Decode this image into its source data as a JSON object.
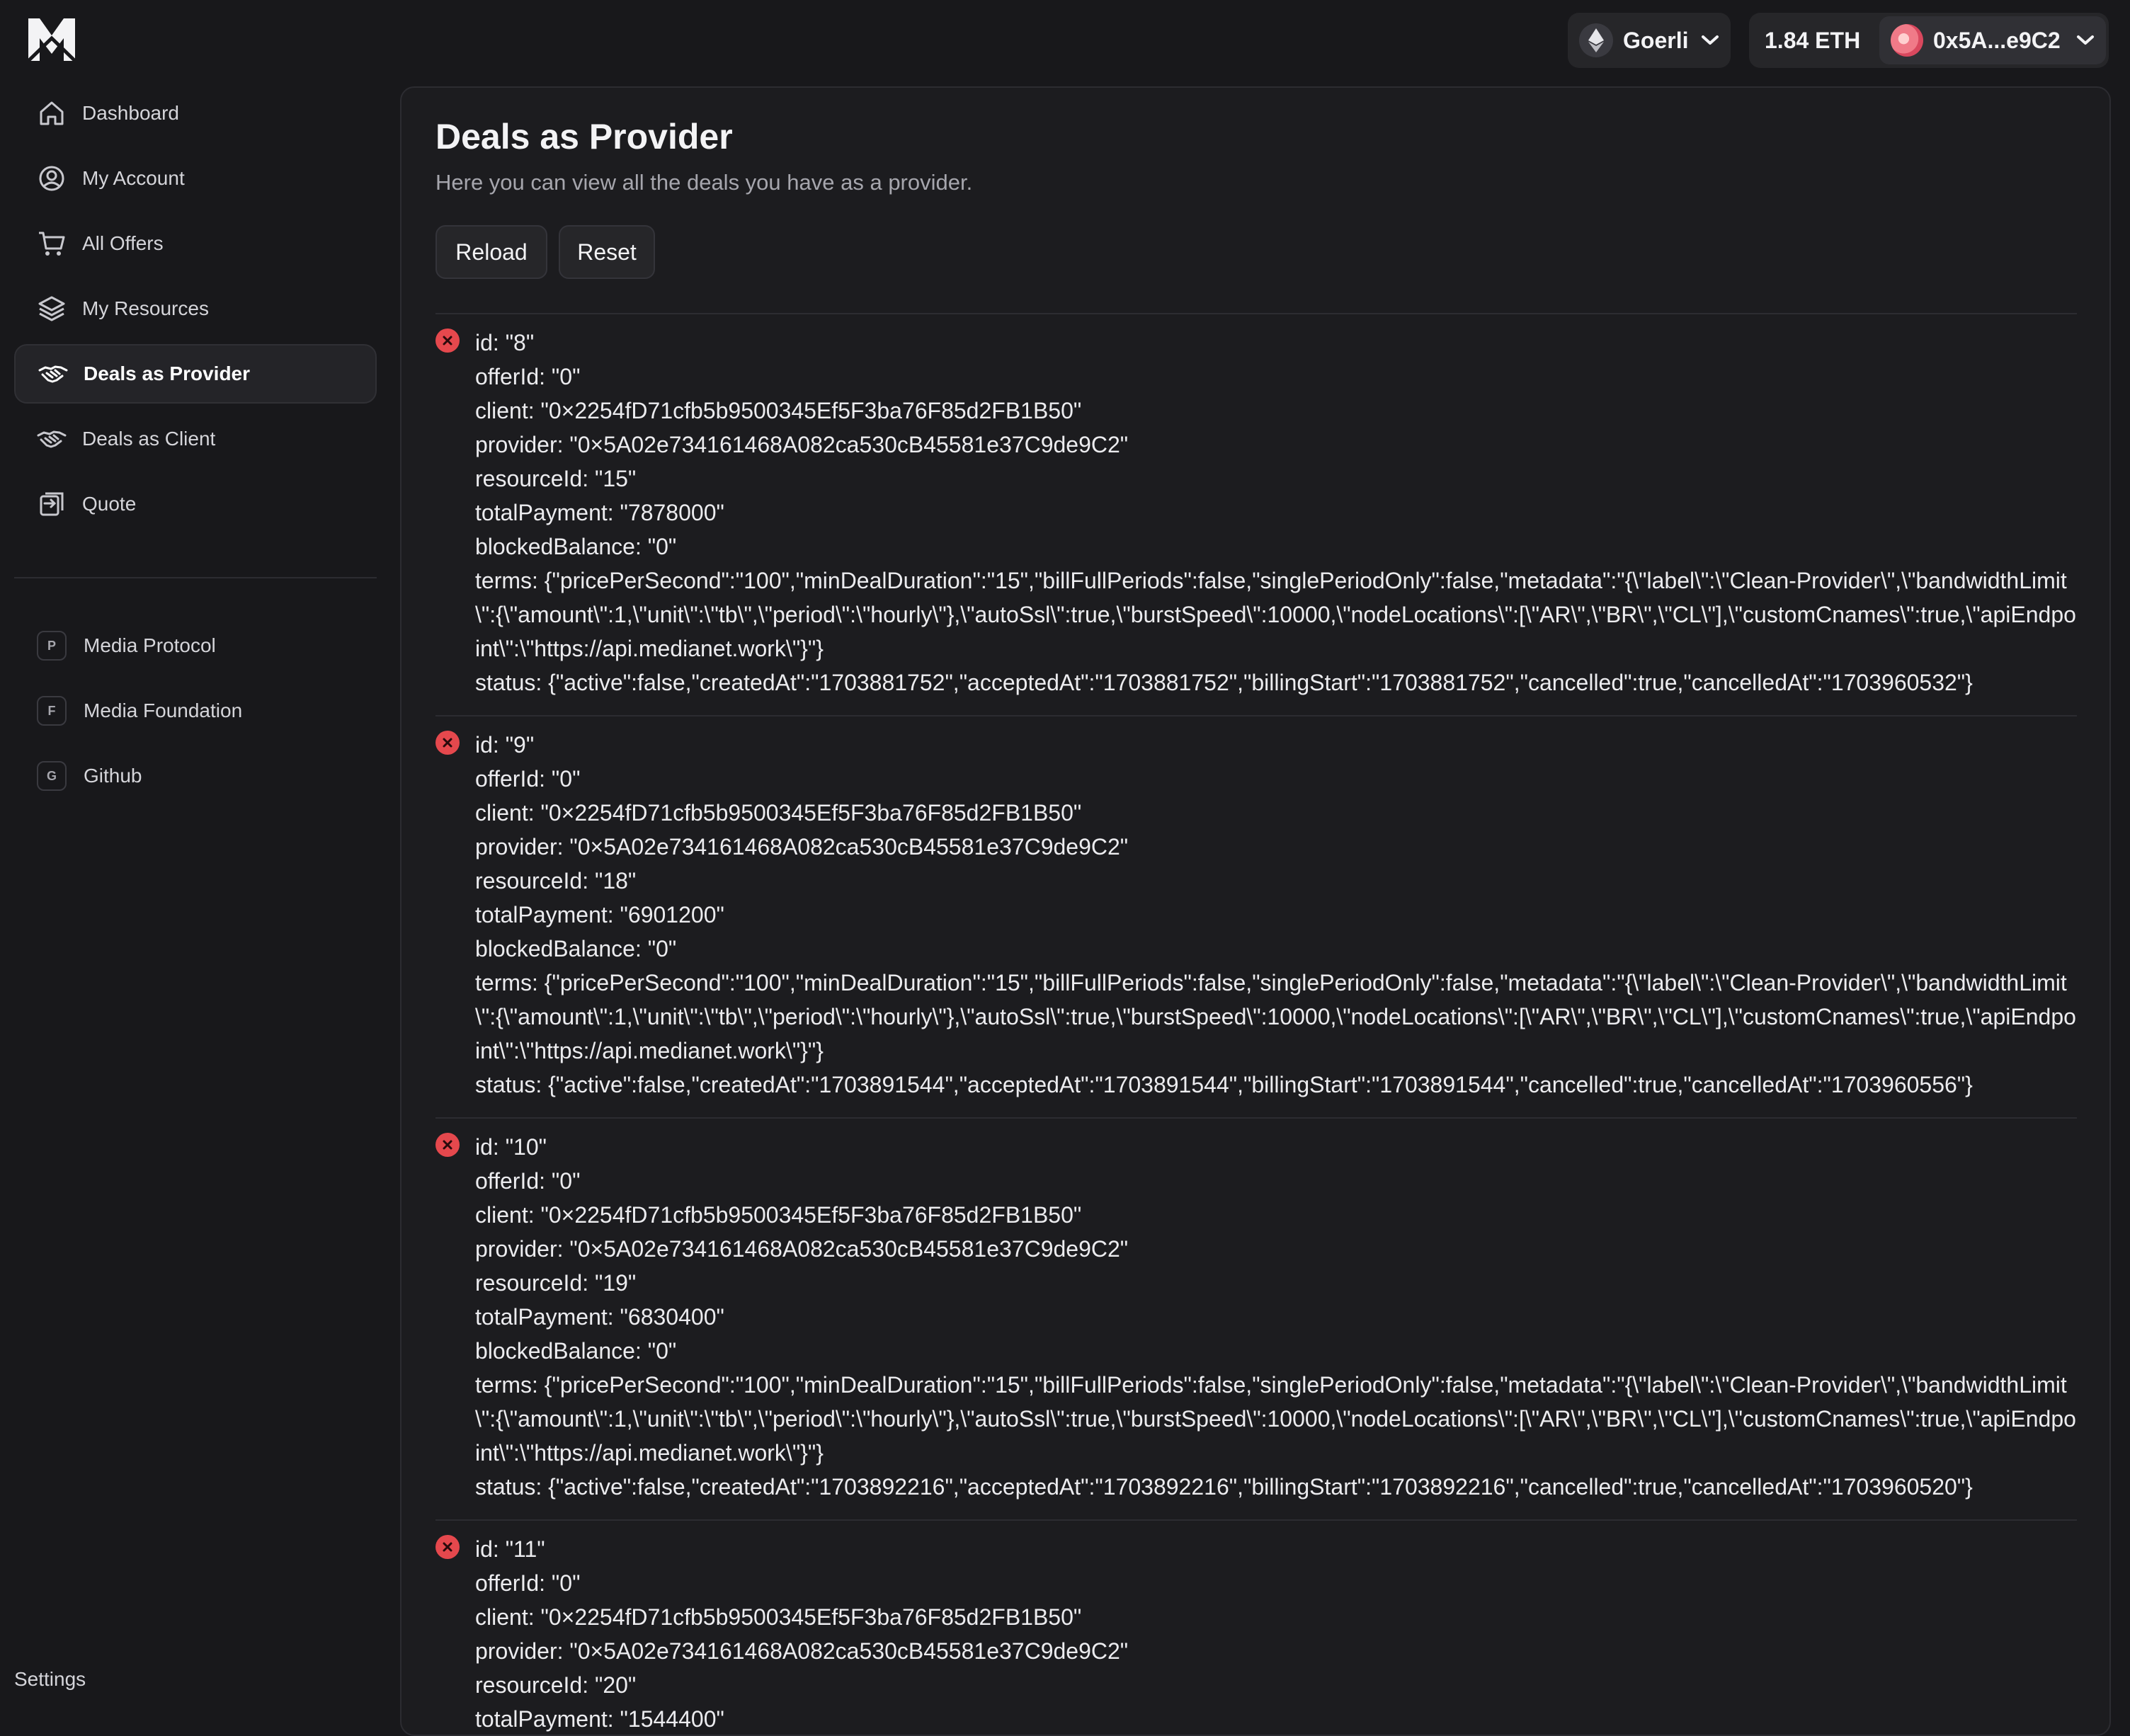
{
  "header": {
    "network_label": "Goerli",
    "balance": "1.84 ETH",
    "address": "0x5A...e9C2"
  },
  "sidebar": {
    "items": [
      {
        "label": "Dashboard",
        "icon": "home-icon"
      },
      {
        "label": "My Account",
        "icon": "user-circle-icon"
      },
      {
        "label": "All Offers",
        "icon": "cart-icon"
      },
      {
        "label": "My Resources",
        "icon": "layers-icon"
      },
      {
        "label": "Deals as Provider",
        "icon": "handshake-icon",
        "active": true
      },
      {
        "label": "Deals as Client",
        "icon": "handshake-icon"
      },
      {
        "label": "Quote",
        "icon": "quote-icon"
      }
    ],
    "links": [
      {
        "letter": "P",
        "label": "Media Protocol"
      },
      {
        "letter": "F",
        "label": "Media Foundation"
      },
      {
        "letter": "G",
        "label": "Github"
      }
    ],
    "settings_label": "Settings"
  },
  "main": {
    "title": "Deals as Provider",
    "subtitle": "Here you can view all the deals you have as a provider.",
    "reload_label": "Reload",
    "reset_label": "Reset",
    "deals": [
      {
        "id": "id: \"8\"",
        "offerId": "offerId: \"0\"",
        "client": "client: \"0×2254fD71cfb5b9500345Ef5F3ba76F85d2FB1B50\"",
        "provider": "provider: \"0×5A02e734161468A082ca530cB45581e37C9de9C2\"",
        "resourceId": "resourceId: \"15\"",
        "totalPayment": "totalPayment: \"7878000\"",
        "blockedBalance": "blockedBalance: \"0\"",
        "terms": "terms: {\"pricePerSecond\":\"100\",\"minDealDuration\":\"15\",\"billFullPeriods\":false,\"singlePeriodOnly\":false,\"metadata\":\"{\\\"label\\\":\\\"Clean-Provider\\\",\\\"bandwidthLimit\\\":{\\\"amount\\\":1,\\\"unit\\\":\\\"tb\\\",\\\"period\\\":\\\"hourly\\\"},\\\"autoSsl\\\":true,\\\"burstSpeed\\\":10000,\\\"nodeLocations\\\":[\\\"AR\\\",\\\"BR\\\",\\\"CL\\\"],\\\"customCnames\\\":true,\\\"apiEndpoint\\\":\\\"https://api.medianet.work\\\"}\"}",
        "status": "status: {\"active\":false,\"createdAt\":\"1703881752\",\"acceptedAt\":\"1703881752\",\"billingStart\":\"1703881752\",\"cancelled\":true,\"cancelledAt\":\"1703960532\"}"
      },
      {
        "id": "id: \"9\"",
        "offerId": "offerId: \"0\"",
        "client": "client: \"0×2254fD71cfb5b9500345Ef5F3ba76F85d2FB1B50\"",
        "provider": "provider: \"0×5A02e734161468A082ca530cB45581e37C9de9C2\"",
        "resourceId": "resourceId: \"18\"",
        "totalPayment": "totalPayment: \"6901200\"",
        "blockedBalance": "blockedBalance: \"0\"",
        "terms": "terms: {\"pricePerSecond\":\"100\",\"minDealDuration\":\"15\",\"billFullPeriods\":false,\"singlePeriodOnly\":false,\"metadata\":\"{\\\"label\\\":\\\"Clean-Provider\\\",\\\"bandwidthLimit\\\":{\\\"amount\\\":1,\\\"unit\\\":\\\"tb\\\",\\\"period\\\":\\\"hourly\\\"},\\\"autoSsl\\\":true,\\\"burstSpeed\\\":10000,\\\"nodeLocations\\\":[\\\"AR\\\",\\\"BR\\\",\\\"CL\\\"],\\\"customCnames\\\":true,\\\"apiEndpoint\\\":\\\"https://api.medianet.work\\\"}\"}",
        "status": "status: {\"active\":false,\"createdAt\":\"1703891544\",\"acceptedAt\":\"1703891544\",\"billingStart\":\"1703891544\",\"cancelled\":true,\"cancelledAt\":\"1703960556\"}"
      },
      {
        "id": "id: \"10\"",
        "offerId": "offerId: \"0\"",
        "client": "client: \"0×2254fD71cfb5b9500345Ef5F3ba76F85d2FB1B50\"",
        "provider": "provider: \"0×5A02e734161468A082ca530cB45581e37C9de9C2\"",
        "resourceId": "resourceId: \"19\"",
        "totalPayment": "totalPayment: \"6830400\"",
        "blockedBalance": "blockedBalance: \"0\"",
        "terms": "terms: {\"pricePerSecond\":\"100\",\"minDealDuration\":\"15\",\"billFullPeriods\":false,\"singlePeriodOnly\":false,\"metadata\":\"{\\\"label\\\":\\\"Clean-Provider\\\",\\\"bandwidthLimit\\\":{\\\"amount\\\":1,\\\"unit\\\":\\\"tb\\\",\\\"period\\\":\\\"hourly\\\"},\\\"autoSsl\\\":true,\\\"burstSpeed\\\":10000,\\\"nodeLocations\\\":[\\\"AR\\\",\\\"BR\\\",\\\"CL\\\"],\\\"customCnames\\\":true,\\\"apiEndpoint\\\":\\\"https://api.medianet.work\\\"}\"}",
        "status": "status: {\"active\":false,\"createdAt\":\"1703892216\",\"acceptedAt\":\"1703892216\",\"billingStart\":\"1703892216\",\"cancelled\":true,\"cancelledAt\":\"1703960520\"}"
      },
      {
        "id": "id: \"11\"",
        "offerId": "offerId: \"0\"",
        "client": "client: \"0×2254fD71cfb5b9500345Ef5F3ba76F85d2FB1B50\"",
        "provider": "provider: \"0×5A02e734161468A082ca530cB45581e37C9de9C2\"",
        "resourceId": "resourceId: \"20\"",
        "totalPayment": "totalPayment: \"1544400\""
      }
    ]
  },
  "colors": {
    "background": "#18181b",
    "panel": "#1c1c1f",
    "danger": "#e5484d"
  }
}
